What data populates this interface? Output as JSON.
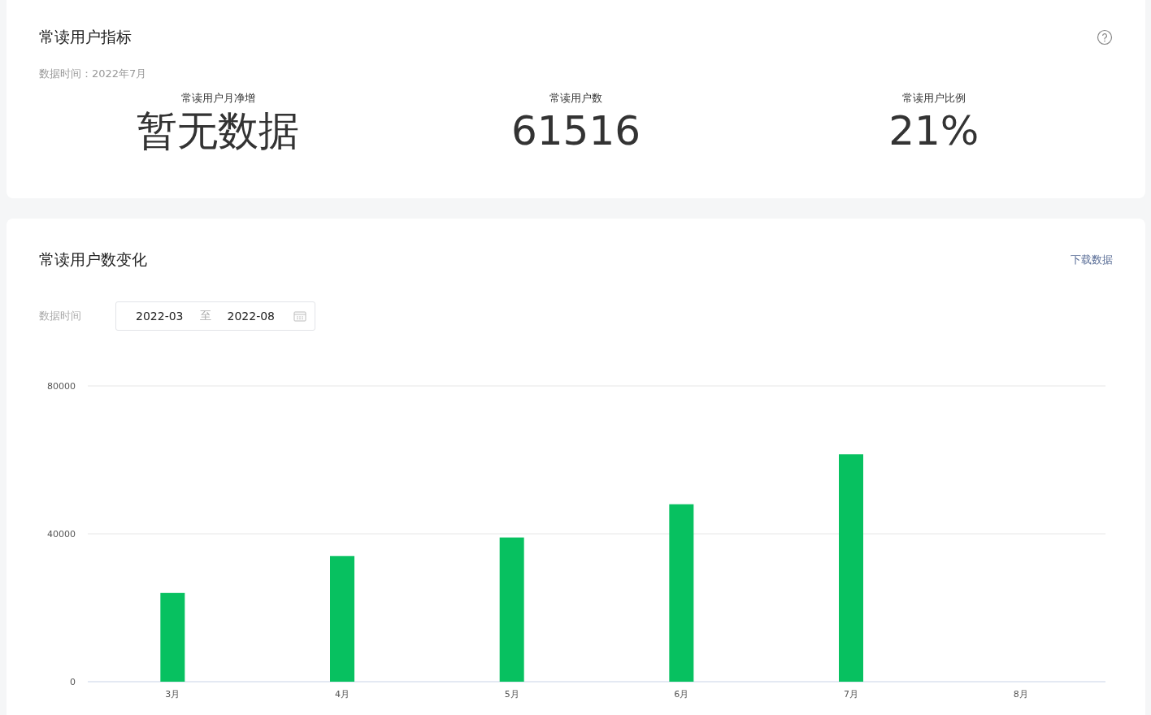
{
  "indicators": {
    "title": "常读用户指标",
    "data_time": "数据时间：2022年7月",
    "metrics": [
      {
        "label": "常读用户月净增",
        "value": "暂无数据"
      },
      {
        "label": "常读用户数",
        "value": "61516"
      },
      {
        "label": "常读用户比例",
        "value": "21%"
      }
    ]
  },
  "trend": {
    "title": "常读用户数变化",
    "download_link": "下载数据",
    "date_label": "数据时间",
    "date_range": {
      "start": "2022-03",
      "separator": "至",
      "end": "2022-08"
    },
    "chart_data": {
      "type": "bar",
      "categories": [
        "3月",
        "4月",
        "5月",
        "6月",
        "7月",
        "8月"
      ],
      "values": [
        24000,
        34000,
        39000,
        48000,
        61500,
        null
      ],
      "ylim": [
        0,
        80000
      ],
      "yticks": [
        0,
        40000,
        80000
      ]
    }
  }
}
